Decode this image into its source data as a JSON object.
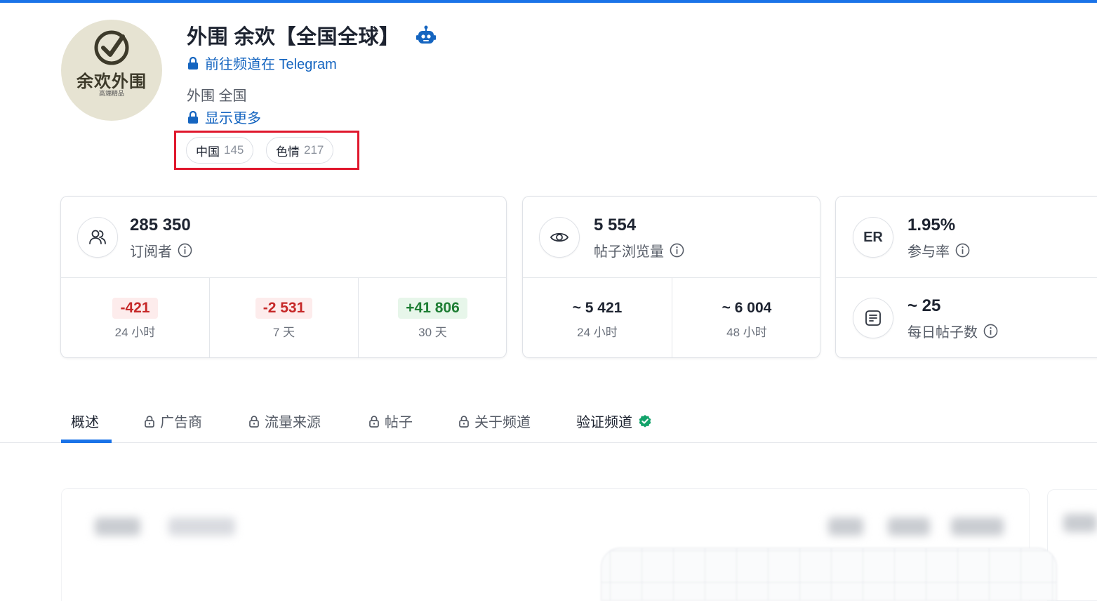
{
  "channel": {
    "avatar_text": "余欢外围",
    "avatar_subtext": "高端精品",
    "title": "外围 余欢【全国全球】",
    "telegram_link": "前往频道在 Telegram",
    "description": "外围 全国",
    "show_more": "显示更多"
  },
  "tags": [
    {
      "name": "中国",
      "count": "145"
    },
    {
      "name": "色情",
      "count": "217"
    }
  ],
  "subscribers": {
    "value": "285 350",
    "label": "订阅者",
    "changes": [
      {
        "value": "-421",
        "period": "24 小时",
        "trend": "negative"
      },
      {
        "value": "-2 531",
        "period": "7 天",
        "trend": "negative"
      },
      {
        "value": "+41 806",
        "period": "30 天",
        "trend": "positive"
      }
    ]
  },
  "views": {
    "value": "5 554",
    "label": "帖子浏览量",
    "periods": [
      {
        "value": "~ 5 421",
        "period": "24 小时"
      },
      {
        "value": "~ 6 004",
        "period": "48 小时"
      }
    ]
  },
  "engagement": {
    "icon_text": "ER",
    "value": "1.95%",
    "label": "参与率",
    "daily_posts_value": "~ 25",
    "daily_posts_label": "每日帖子数"
  },
  "tabs": [
    {
      "label": "概述",
      "locked": false,
      "active": true
    },
    {
      "label": "广告商",
      "locked": true,
      "active": false
    },
    {
      "label": "流量来源",
      "locked": true,
      "active": false
    },
    {
      "label": "帖子",
      "locked": true,
      "active": false
    },
    {
      "label": "关于频道",
      "locked": true,
      "active": false
    },
    {
      "label": "验证频道",
      "locked": false,
      "active": false,
      "verified": true
    }
  ],
  "colors": {
    "accent": "#1a73e8",
    "link": "#1565c0",
    "negative": "#c62828",
    "positive": "#1e7e34",
    "highlight_box": "#e0182d",
    "verified": "#12a36a"
  },
  "icons": {
    "lock": "lock-icon",
    "bot": "robot-icon",
    "subscribers": "users-icon",
    "views": "eye-icon",
    "info": "info-icon",
    "posts": "document-icon",
    "verified": "verified-badge-icon"
  }
}
